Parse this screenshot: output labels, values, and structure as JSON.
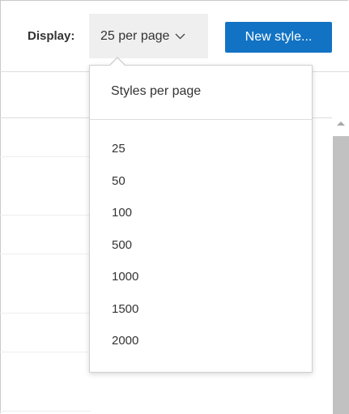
{
  "toolbar": {
    "display_label": "Display:",
    "per_page_value": "25 per page",
    "new_style_label": "New style..."
  },
  "dropdown": {
    "title": "Styles per page",
    "options": [
      "25",
      "50",
      "100",
      "500",
      "1000",
      "1500",
      "2000"
    ]
  },
  "colors": {
    "primary_button": "#1273c4",
    "select_background": "#efefef"
  },
  "icons": {
    "select_chevron": "chevron-down-icon",
    "scroll_up": "scroll-up-arrow-icon"
  }
}
